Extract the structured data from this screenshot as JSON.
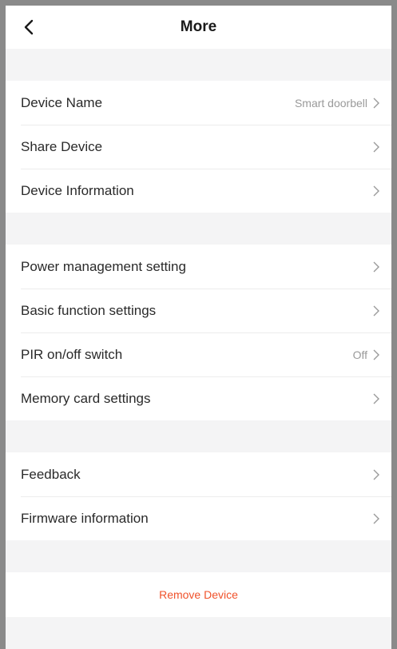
{
  "header": {
    "title": "More",
    "back_icon": "chevron-left-icon"
  },
  "sections": [
    {
      "items": [
        {
          "label": "Device Name",
          "value": "Smart doorbell",
          "icon": "chevron-right-icon"
        },
        {
          "label": "Share Device",
          "value": "",
          "icon": "chevron-right-icon"
        },
        {
          "label": "Device Information",
          "value": "",
          "icon": "chevron-right-icon"
        }
      ]
    },
    {
      "items": [
        {
          "label": "Power management setting",
          "value": "",
          "icon": "chevron-right-icon"
        },
        {
          "label": "Basic function settings",
          "value": "",
          "icon": "chevron-right-icon"
        },
        {
          "label": "PIR on/off switch",
          "value": "Off",
          "icon": "chevron-right-icon"
        },
        {
          "label": "Memory card settings",
          "value": "",
          "icon": "chevron-right-icon"
        }
      ]
    },
    {
      "items": [
        {
          "label": "Feedback",
          "value": "",
          "icon": "chevron-right-icon"
        },
        {
          "label": "Firmware information",
          "value": "",
          "icon": "chevron-right-icon"
        }
      ]
    }
  ],
  "remove_device": {
    "label": "Remove Device",
    "color": "#f0522b"
  },
  "colors": {
    "background": "#f4f4f5",
    "card": "#ffffff",
    "text": "#2a2a2a",
    "secondary_text": "#9a9a9a",
    "frame": "#8a8a8a"
  }
}
